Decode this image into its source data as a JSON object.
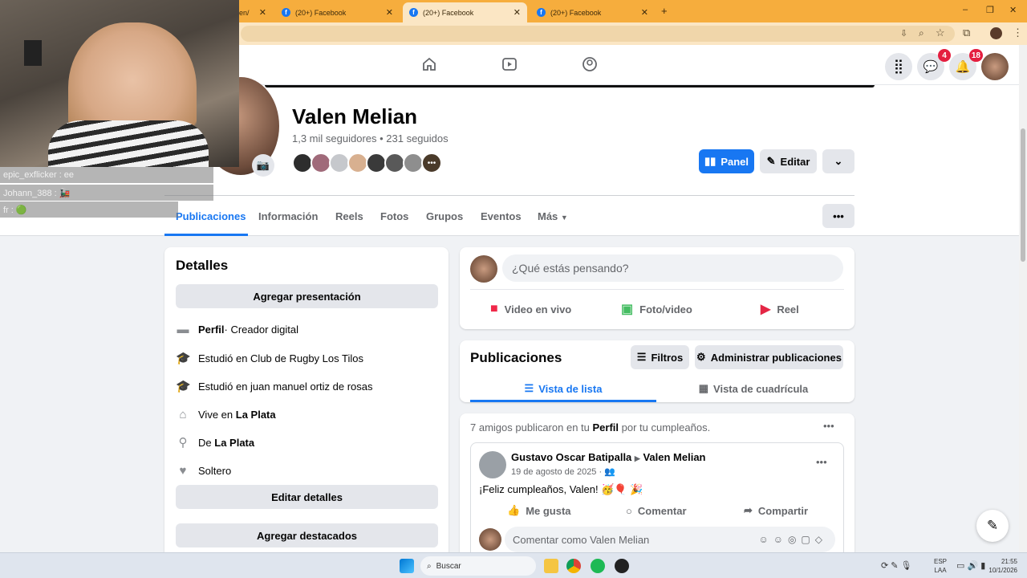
{
  "browser": {
    "tabs": [
      {
        "label": "len/",
        "active": false
      },
      {
        "label": "(20+) Facebook",
        "active": false
      },
      {
        "label": "(20+) Facebook",
        "active": true
      },
      {
        "label": "(20+) Facebook",
        "active": false
      }
    ],
    "new_tab": "+",
    "window_min": "–",
    "window_max": "❐",
    "window_close": "✕"
  },
  "nav": {
    "messenger_badge": "4",
    "notifications_badge": "18"
  },
  "profile": {
    "name": "Valen Melian",
    "followers": "1,3 mil seguidores • 231 seguidos",
    "panel_label": "Panel",
    "edit_label": "Editar",
    "tabs": [
      "Publicaciones",
      "Información",
      "Reels",
      "Fotos",
      "Grupos",
      "Eventos",
      "Más"
    ]
  },
  "details": {
    "title": "Detalles",
    "add_intro": "Agregar presentación",
    "rows": [
      {
        "bold": "Perfil",
        "text": " · Creador digital",
        "icon": "briefcase-icon"
      },
      {
        "bold": "",
        "text": "Estudió en Club de Rugby Los Tilos",
        "icon": "graduation-icon"
      },
      {
        "bold": "",
        "text": "Estudió en juan manuel ortiz de rosas",
        "icon": "graduation-icon"
      },
      {
        "pre": "Vive en ",
        "bold": "La Plata",
        "icon": "home-icon"
      },
      {
        "pre": "De ",
        "bold": "La Plata",
        "icon": "location-icon"
      },
      {
        "bold": "",
        "text": "Soltero",
        "icon": "heart-icon"
      }
    ],
    "edit_details": "Editar detalles",
    "add_featured": "Agregar destacados"
  },
  "composer": {
    "placeholder": "¿Qué estás pensando?",
    "live": "Video en vivo",
    "photo": "Foto/video",
    "reel": "Reel"
  },
  "posts": {
    "title": "Publicaciones",
    "filters": "Filtros",
    "manage": "Administrar publicaciones",
    "list_view": "Vista de lista",
    "grid_view": "Vista de cuadrícula"
  },
  "post": {
    "summary_pre": "7 amigos publicaron en tu ",
    "summary_bold": "Perfil",
    "summary_post": " por tu cumpleaños.",
    "author": "Gustavo Oscar Batipalla",
    "target": "Valen Melian",
    "date": "19 de agosto de 2025 · ",
    "text": "¡Feliz cumpleaños, Valen! 🥳🎈 🎉",
    "like": "Me gusta",
    "comment": "Comentar",
    "share": "Compartir",
    "comment_placeholder": "Comentar como Valen Melian"
  },
  "overlay_chat": [
    {
      "text": "epic_exflicker : ee"
    },
    {
      "text": "Johann_388 : 🚂"
    },
    {
      "text": "fr : 🟢"
    }
  ],
  "taskbar": {
    "search": "Buscar",
    "lang": "ESP",
    "lang2": "LAA",
    "time": "21:55",
    "date": "10/1/2026"
  }
}
